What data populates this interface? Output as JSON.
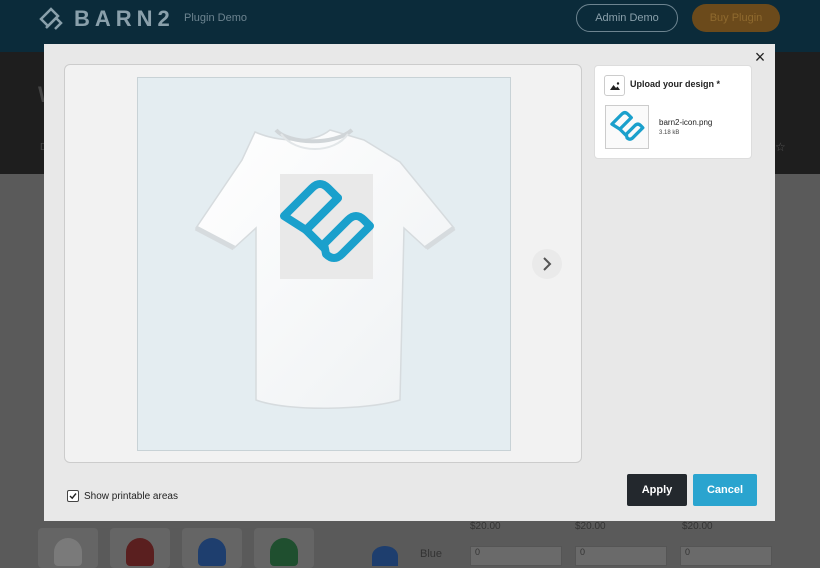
{
  "background": {
    "logo_text": "BARN2",
    "plugin_demo": "Plugin Demo",
    "admin_demo": "Admin Demo",
    "buy_plugin": "Buy Plugin",
    "heading_letter": "W",
    "sub_letter": "D",
    "prices": [
      "$20.00",
      "$20.00",
      "$20.00"
    ],
    "quantities": [
      "0",
      "0",
      "0"
    ],
    "color_label": "Blue"
  },
  "modal": {
    "close_label": "×",
    "upload": {
      "title": "Upload your design *",
      "file_name": "barn2-icon.png",
      "file_size": "3.18 kB"
    },
    "show_printable_label": "Show printable areas",
    "show_printable_checked": true,
    "apply_label": "Apply",
    "cancel_label": "Cancel"
  },
  "colors": {
    "accent": "#2aa4cf",
    "apply_bg": "#23282d",
    "logo_blue": "#1aa0cc"
  },
  "icons": {
    "close": "close-icon",
    "next": "chevron-right-icon",
    "upload": "image-icon",
    "checkbox": "check-icon"
  }
}
